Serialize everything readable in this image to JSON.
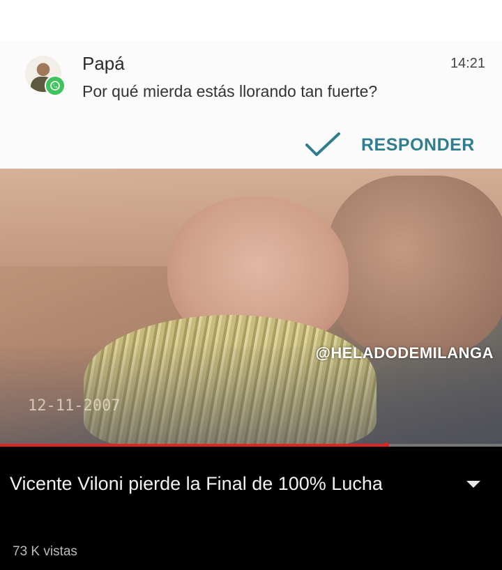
{
  "notification": {
    "sender": "Papá",
    "time": "14:21",
    "message": "Por qué mierda estás llorando tan fuerte?",
    "reply_label": "RESPONDER",
    "avatar_icon": "contact-photo",
    "badge_icon": "whatsapp-icon",
    "reply_icon": "checkmark-icon",
    "accent_color": "#2e7e8e"
  },
  "video": {
    "watermark": "@HELADODEMILANGA",
    "overlay_timestamp": "12-11-2007",
    "progress": 0.77,
    "progress_color": "#e02424"
  },
  "info": {
    "title": "Vicente Viloni pierde la Final de 100% Lucha",
    "views": "73 K vistas",
    "expand_icon": "chevron-down-icon"
  }
}
